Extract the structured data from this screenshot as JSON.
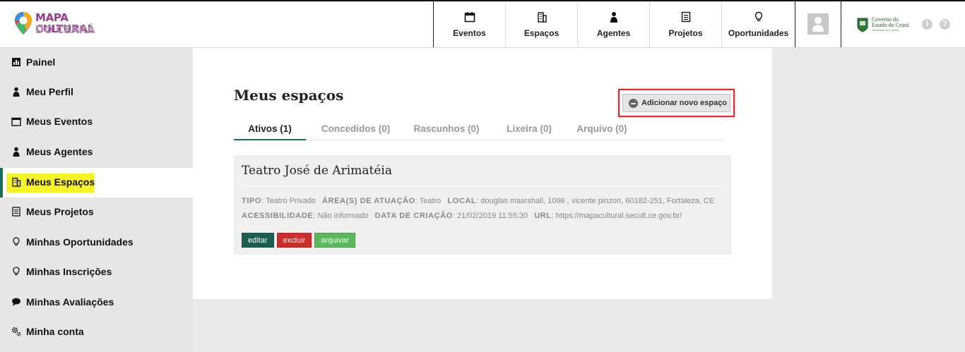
{
  "brand": {
    "line1": "MAPA CULTURAL",
    "line2": "DO CEARÁ"
  },
  "nav": [
    {
      "label": "Eventos",
      "icon": "calendar-icon"
    },
    {
      "label": "Espaços",
      "icon": "building-icon"
    },
    {
      "label": "Agentes",
      "icon": "person-icon"
    },
    {
      "label": "Projetos",
      "icon": "document-icon"
    },
    {
      "label": "Oportunidades",
      "icon": "lightbulb-icon"
    }
  ],
  "gov": {
    "line1": "Governo do",
    "line2": "Estado do Ceará",
    "line3": "Secretaria da Cultura"
  },
  "sidebar": {
    "items": [
      {
        "label": "Painel",
        "icon": "chart-icon"
      },
      {
        "label": "Meu Perfil",
        "icon": "person-icon"
      },
      {
        "label": "Meus Eventos",
        "icon": "calendar-icon"
      },
      {
        "label": "Meus Agentes",
        "icon": "person-icon"
      },
      {
        "label": "Meus Espaços",
        "icon": "building-icon",
        "active": true
      },
      {
        "label": "Meus Projetos",
        "icon": "document-icon"
      },
      {
        "label": "Minhas Oportunidades",
        "icon": "lightbulb-icon"
      },
      {
        "label": "Minhas Inscrições",
        "icon": "lightbulb-icon"
      },
      {
        "label": "Minhas Avaliações",
        "icon": "speech-bubble-icon"
      },
      {
        "label": "Minha conta",
        "icon": "gears-icon"
      }
    ]
  },
  "main": {
    "title": "Meus espaços",
    "add_button": "Adicionar novo espaço",
    "tabs": [
      "Ativos (1)",
      "Concedidos (0)",
      "Rascunhos (0)",
      "Lixeira (0)",
      "Arquivo (0)"
    ],
    "card": {
      "title": "Teatro José de Arimatéia",
      "tipo_label": "TIPO",
      "tipo": "Teatro Privado",
      "area_label": "ÁREA(S) DE ATUAÇÃO",
      "area": "Teatro",
      "local_label": "LOCAL",
      "local": "douglas masrshall, 1066 , vicente pinzon, 60182-251, Fortaleza, CE",
      "acess_label": "ACESSIBILIDADE",
      "acess": "Não informado",
      "data_label": "DATA DE CRIAÇÃO",
      "data": "21/02/2019 11:55:30",
      "url_label": "URL",
      "url": "https://mapacultural.secult.ce.gov.br/",
      "actions": [
        {
          "label": "editar",
          "color": "#1b5e50"
        },
        {
          "label": "excluir",
          "color": "#c9302c"
        },
        {
          "label": "arquivar",
          "color": "#5cb85c"
        }
      ]
    }
  },
  "colors": {
    "accent": "#1b6e5b",
    "highlight": "#f5f22a",
    "annotation": "#d32f2f"
  }
}
